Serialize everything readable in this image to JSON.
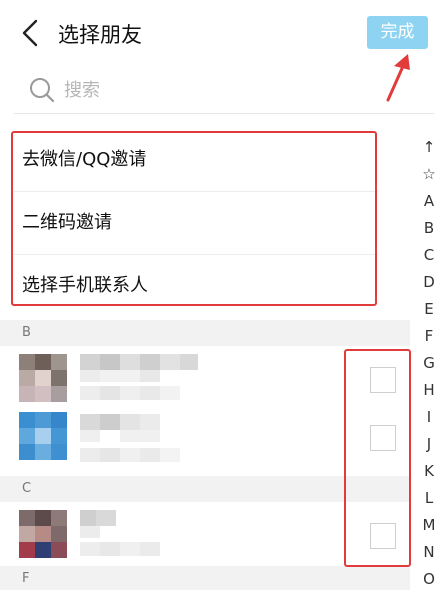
{
  "header": {
    "title": "选择朋友",
    "done_label": "完成"
  },
  "search": {
    "placeholder": "搜索"
  },
  "options": [
    {
      "label": "去微信/QQ邀请"
    },
    {
      "label": "二维码邀请"
    },
    {
      "label": "选择手机联系人"
    }
  ],
  "sections": [
    {
      "letter": "B"
    },
    {
      "letter": "C"
    },
    {
      "letter": "F"
    }
  ],
  "index": [
    "↑",
    "☆",
    "A",
    "B",
    "C",
    "D",
    "E",
    "F",
    "G",
    "H",
    "I",
    "J",
    "K",
    "L",
    "M",
    "N",
    "O"
  ],
  "colors": {
    "done_bg": "#8fd3f3",
    "annotation_red": "#e23b3b"
  },
  "icons": [
    "back-chevron-icon",
    "search-icon",
    "red-arrow-icon"
  ]
}
